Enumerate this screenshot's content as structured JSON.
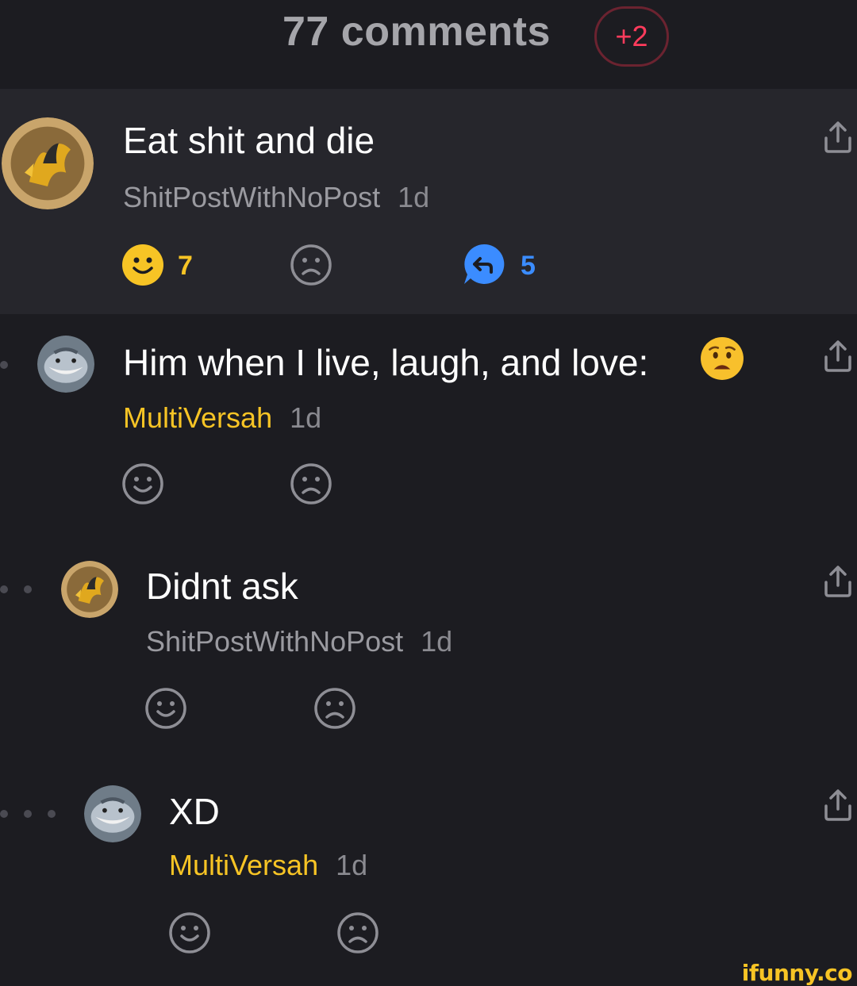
{
  "header": {
    "title": "77 comments",
    "badge": "+2"
  },
  "colors": {
    "background": "#1c1c21",
    "highlight_row": "#26262c",
    "gold_username": "#f7c425",
    "badge_red": "#ff3b5c",
    "reply_blue": "#3b8cff"
  },
  "comments": [
    {
      "text": "Eat shit and die",
      "user": "ShitPostWithNoPost",
      "time": "1d",
      "smile_count": "7",
      "reply_count": "5",
      "avatar_icon": "dragon-avatar-icon"
    },
    {
      "text": "Him when I live, laugh, and love:",
      "user": "MultiVersah",
      "time": "1d",
      "avatar_icon": "shark-avatar-icon",
      "emoji_icon": "anguished-face-emoji-icon"
    },
    {
      "text": "Didnt ask",
      "user": "ShitPostWithNoPost",
      "time": "1d",
      "avatar_icon": "dragon-avatar-icon"
    },
    {
      "text": "XD",
      "user": "MultiVersah",
      "time": "1d",
      "avatar_icon": "shark-avatar-icon"
    }
  ],
  "watermark": "ifunny.co"
}
